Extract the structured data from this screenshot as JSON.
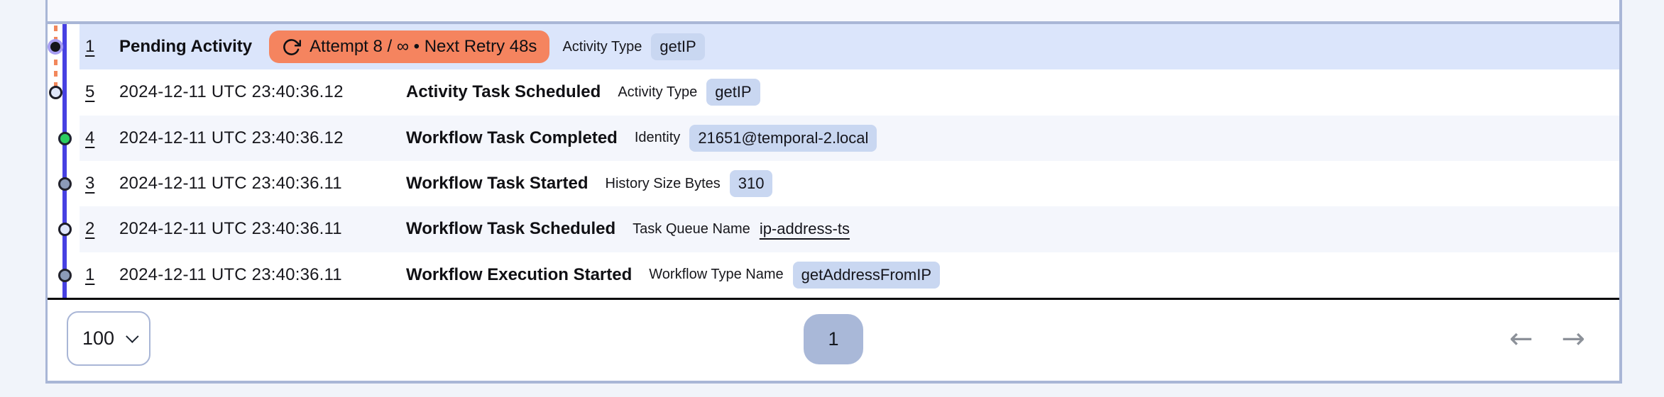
{
  "colors": {
    "page_bg": "#f1f4fa",
    "panel_border": "#a9b6d6",
    "row_selected": "#dbe5fb",
    "row_alt": "#f4f6fc",
    "timeline_blue": "#4741e2",
    "branch_orange": "#f2875c",
    "pending_ring": "#a79ef2",
    "pending_badge": "#f5845f",
    "badge_bg": "#c9d7f1",
    "marker_green": "#2bcd61",
    "page_btn_bg": "#a9b8d8"
  },
  "events": [
    {
      "id": "1",
      "name": "Pending Activity",
      "retry": "Attempt 8 / ∞ • Next Retry 48s",
      "attr_label": "Activity Type",
      "attr_value": "getIP"
    },
    {
      "id": "5",
      "time": "2024-12-11 UTC 23:40:36.12",
      "name": "Activity Task Scheduled",
      "attr_label": "Activity Type",
      "attr_value": "getIP"
    },
    {
      "id": "4",
      "time": "2024-12-11 UTC 23:40:36.12",
      "name": "Workflow Task Completed",
      "attr_label": "Identity",
      "attr_value": "21651@temporal-2.local"
    },
    {
      "id": "3",
      "time": "2024-12-11 UTC 23:40:36.11",
      "name": "Workflow Task Started",
      "attr_label": "History Size Bytes",
      "attr_value": "310"
    },
    {
      "id": "2",
      "time": "2024-12-11 UTC 23:40:36.11",
      "name": "Workflow Task Scheduled",
      "attr_label": "Task Queue Name",
      "attr_value": "ip-address-ts"
    },
    {
      "id": "1",
      "time": "2024-12-11 UTC 23:40:36.11",
      "name": "Workflow Execution Started",
      "attr_label": "Workflow Type Name",
      "attr_value": "getAddressFromIP"
    }
  ],
  "pagination": {
    "page_size": "100",
    "current_page": "1",
    "prev_label": "←",
    "next_label": "→"
  }
}
